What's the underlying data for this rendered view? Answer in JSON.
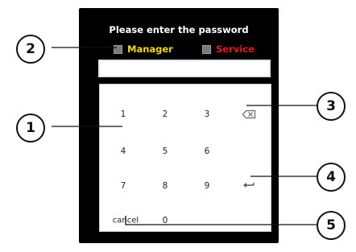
{
  "dialog": {
    "title": "Please enter the password",
    "roles": [
      {
        "label": "Manager",
        "color": "#f0d800"
      },
      {
        "label": "Service",
        "color": "#e01a1a"
      }
    ],
    "password_value": ""
  },
  "keypad": {
    "keys": [
      "1",
      "2",
      "3",
      "4",
      "5",
      "6",
      "7",
      "8",
      "9",
      "0"
    ],
    "cancel_label": "cancel",
    "backspace_icon": "backspace-icon",
    "enter_icon": "enter-arrow-icon"
  },
  "callouts": [
    "1",
    "2",
    "3",
    "4",
    "5"
  ]
}
